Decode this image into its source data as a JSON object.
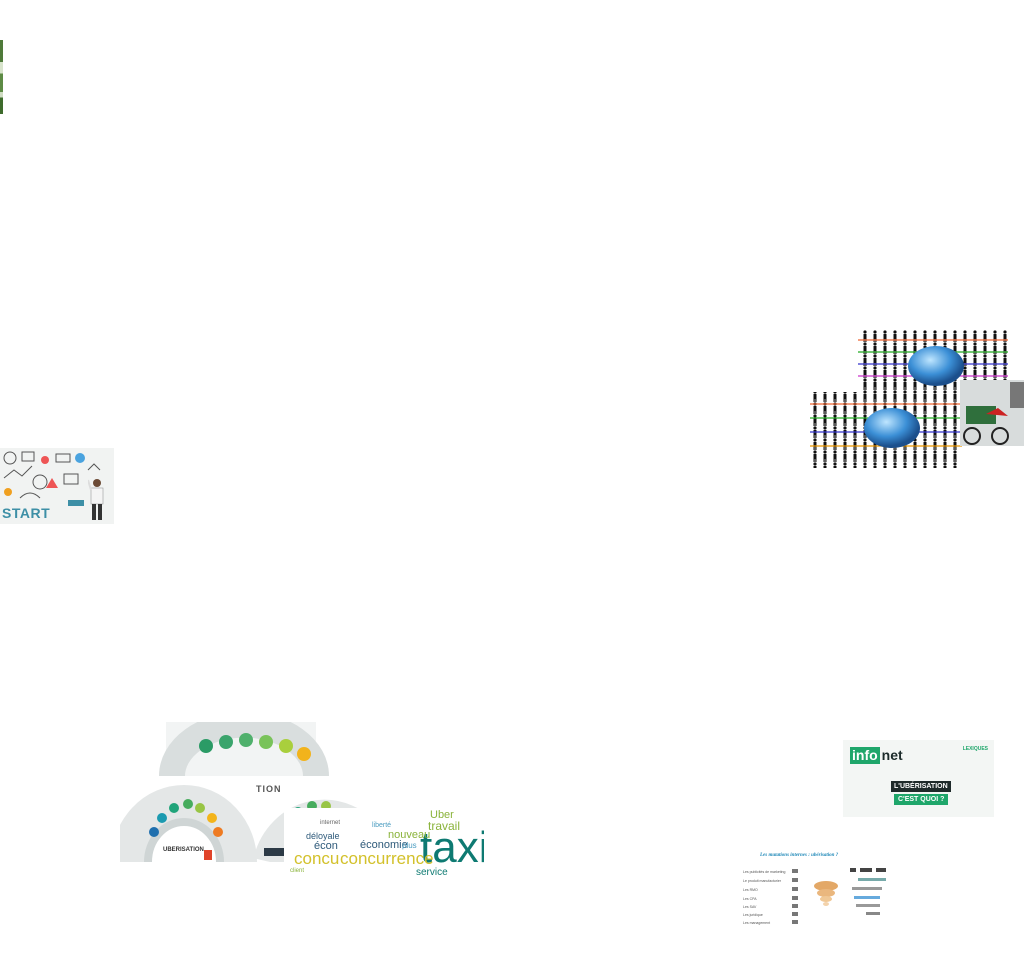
{
  "start_board": {
    "word": "START"
  },
  "wheel": {
    "fragment_text": "TION",
    "center_label": "UBERISATION"
  },
  "word_cloud": {
    "words": [
      "Uber",
      "travail",
      "taxi",
      "concurrence",
      "concu",
      "économie",
      "déloyale",
      "nouveau",
      "service",
      "plus",
      "écon",
      "liberté",
      "internet",
      "client"
    ]
  },
  "infonet_card": {
    "logo_left": "info",
    "logo_right": "net",
    "corner_label": "LEXIQUES",
    "tag_line1": "L'UBÉRISATION",
    "tag_line2": "C'EST QUOI ?"
  },
  "mutations_slide": {
    "title": "Les mutations internes : ubérisation ?",
    "rows": [
      "Les publicités de marketing",
      "Le produit manufacturier",
      "Les RMO",
      "Les CPA",
      "Les SAV",
      "Les juridique",
      "Les management"
    ]
  },
  "colors": {
    "brand_green": "#1ea66a",
    "teal": "#0e7a72",
    "background": "#ffffff"
  }
}
